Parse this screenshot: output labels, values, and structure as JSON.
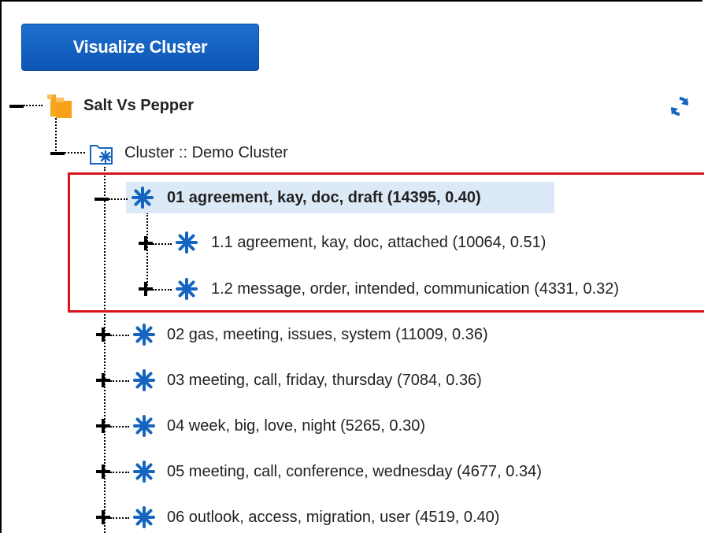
{
  "toolbar": {
    "visualize_label": "Visualize Cluster"
  },
  "tree": {
    "root": {
      "label": "Salt Vs Pepper",
      "icon": "folder-icon"
    },
    "cluster": {
      "label": "Cluster :: Demo Cluster",
      "icon": "cluster-folder-icon"
    },
    "items": [
      {
        "label": "01 agreement, kay, doc, draft (14395, 0.40)",
        "expanded": true,
        "selected": true
      },
      {
        "label": "1.1 agreement, kay, doc, attached (10064, 0.51)",
        "expanded": false
      },
      {
        "label": "1.2 message, order, intended, communication (4331, 0.32)",
        "expanded": false
      },
      {
        "label": "02 gas, meeting, issues, system (11009, 0.36)",
        "expanded": false
      },
      {
        "label": "03 meeting, call, friday, thursday (7084, 0.36)",
        "expanded": false
      },
      {
        "label": "04 week, big, love, night (5265, 0.30)",
        "expanded": false
      },
      {
        "label": "05 meeting, call, conference, wednesday (4677, 0.34)",
        "expanded": false
      },
      {
        "label": "06 outlook, access, migration, user (4519, 0.40)",
        "expanded": false
      }
    ]
  },
  "icons": {
    "refresh": "refresh-icon",
    "cluster_node": "asterisk-icon"
  },
  "colors": {
    "accent": "#1565c0",
    "highlight_box": "#d9141c",
    "selection": "#dce9f7"
  }
}
